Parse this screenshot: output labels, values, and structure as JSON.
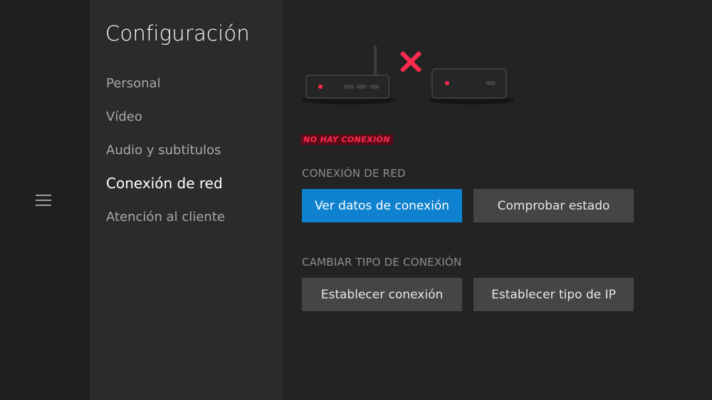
{
  "sidebar": {
    "menu_icon": "hamburger-menu-icon"
  },
  "nav": {
    "title": "Configuración",
    "items": [
      {
        "label": "Personal",
        "active": false
      },
      {
        "label": "Vídeo",
        "active": false
      },
      {
        "label": "Audio y subtítulos",
        "active": false
      },
      {
        "label": "Conexión de red",
        "active": true
      },
      {
        "label": "Atención al cliente",
        "active": false
      }
    ]
  },
  "main": {
    "illustration": {
      "router_icon": "router-icon",
      "disconnect_icon": "disconnected-x-icon",
      "device_icon": "set-top-box-icon"
    },
    "status_badge": "NO HAY CONEXIÓN",
    "network_section": {
      "label": "CONEXIÓN DE RED",
      "view_details_button": "Ver datos de conexión",
      "check_status_button": "Comprobar estado"
    },
    "change_section": {
      "label": "CAMBIAR TIPO DE CONEXIÓN",
      "set_connection_button": "Establecer conexión",
      "set_ip_type_button": "Establecer tipo de IP"
    }
  },
  "colors": {
    "accent": "#0f82cf",
    "error": "#ff2a4f",
    "error_bg": "#5a0c18",
    "indicator": "#ff2a4f"
  }
}
